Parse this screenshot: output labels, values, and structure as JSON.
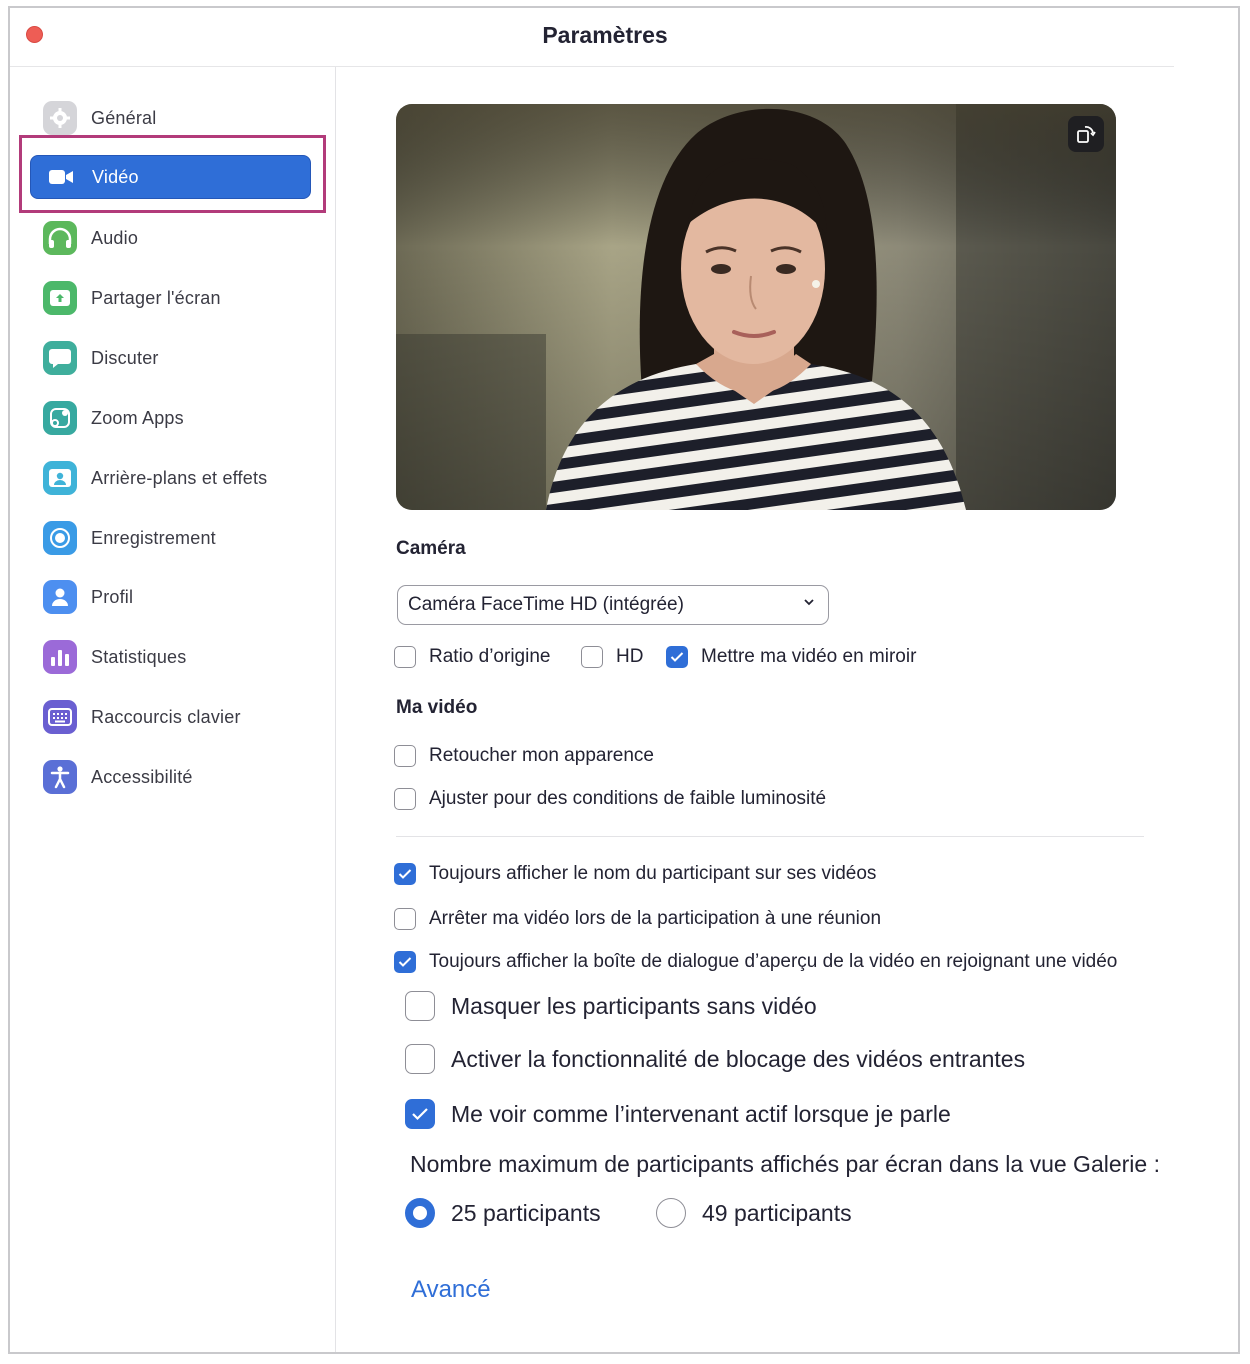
{
  "window": {
    "title": "Paramètres"
  },
  "sidebar": {
    "items": [
      {
        "label": "Général",
        "icon": "gear-icon",
        "color": "#c7c7cc"
      },
      {
        "label": "Vidéo",
        "icon": "video-camera-icon",
        "color": "#ffffff",
        "active": true
      },
      {
        "label": "Audio",
        "icon": "headphones-icon",
        "color": "#5cb85c"
      },
      {
        "label": "Partager l'écran",
        "icon": "share-screen-icon",
        "color": "#4cb86a"
      },
      {
        "label": "Discuter",
        "icon": "chat-bubble-icon",
        "color": "#3fae9c"
      },
      {
        "label": "Zoom Apps",
        "icon": "apps-icon",
        "color": "#37a9a0"
      },
      {
        "label": "Arrière-plans et effets",
        "icon": "background-icon",
        "color": "#3fb3d8"
      },
      {
        "label": "Enregistrement",
        "icon": "record-icon",
        "color": "#3a9be6"
      },
      {
        "label": "Profil",
        "icon": "profile-icon",
        "color": "#4d8ff0"
      },
      {
        "label": "Statistiques",
        "icon": "statistics-icon",
        "color": "#9b6ad8"
      },
      {
        "label": "Raccourcis clavier",
        "icon": "keyboard-icon",
        "color": "#6a5fd1"
      },
      {
        "label": "Accessibilité",
        "icon": "accessibility-icon",
        "color": "#5a6fd6"
      }
    ]
  },
  "camera": {
    "heading": "Caméra",
    "selected": "Caméra FaceTime HD (intégrée)",
    "options": [
      {
        "label": "Ratio d’origine",
        "checked": false
      },
      {
        "label": "HD",
        "checked": false
      },
      {
        "label": "Mettre ma vidéo en miroir",
        "checked": true
      }
    ]
  },
  "my_video": {
    "heading": "Ma vidéo",
    "options": [
      {
        "label": "Retoucher mon apparence",
        "checked": false
      },
      {
        "label": "Ajuster pour des conditions de faible luminosité",
        "checked": false
      }
    ]
  },
  "general_options": [
    {
      "label": "Toujours afficher le nom du participant sur ses vidéos",
      "checked": true
    },
    {
      "label": "Arrêter ma vidéo lors de la participation à une réunion",
      "checked": false
    },
    {
      "label": "Toujours afficher la boîte de dialogue d’aperçu de la vidéo en rejoignant une vidéo",
      "checked": true
    }
  ],
  "zoomed_options": [
    {
      "label": "Masquer les participants sans vidéo",
      "checked": false
    },
    {
      "label": "Activer la fonctionnalité de blocage des vidéos entrantes",
      "checked": false
    },
    {
      "label": "Me voir comme l’intervenant actif lorsque je parle",
      "checked": true
    }
  ],
  "gallery": {
    "label": "Nombre maximum de participants affichés par écran dans la vue Galerie :",
    "options": [
      {
        "label": "25 participants",
        "selected": true
      },
      {
        "label": "49 participants",
        "selected": false
      }
    ]
  },
  "advanced_link": "Avancé",
  "colors": {
    "accent": "#2f6ed7",
    "highlight_border": "#b23b7a",
    "close": "#ee5d55"
  }
}
